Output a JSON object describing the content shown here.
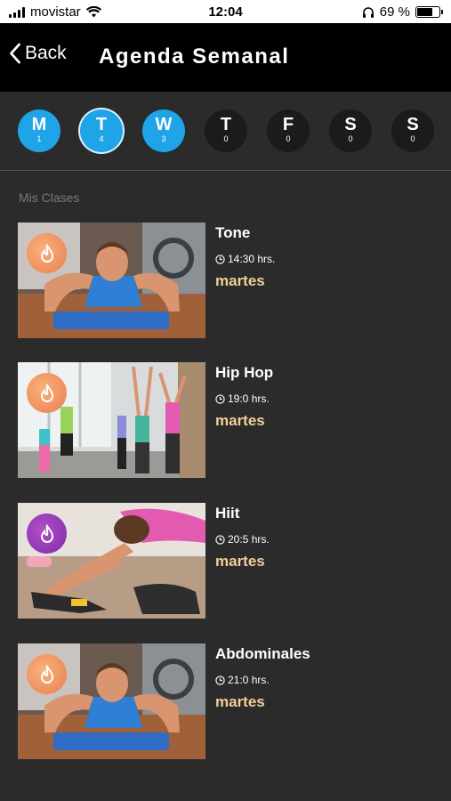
{
  "status_bar": {
    "carrier": "movistar",
    "time": "12:04",
    "battery": "69 %",
    "battery_level": 0.69
  },
  "nav": {
    "back_label": "Back",
    "title": "Agenda Semanal"
  },
  "days": [
    {
      "letter": "M",
      "count": "1",
      "active": true
    },
    {
      "letter": "T",
      "count": "4",
      "active": true,
      "selected": true
    },
    {
      "letter": "W",
      "count": "3",
      "active": true
    },
    {
      "letter": "T",
      "count": "0",
      "active": false
    },
    {
      "letter": "F",
      "count": "0",
      "active": false
    },
    {
      "letter": "S",
      "count": "0",
      "active": false
    },
    {
      "letter": "S",
      "count": "0",
      "active": false
    }
  ],
  "section_label": "Mis Clases",
  "classes": [
    {
      "name": "Tone",
      "time": "14:30 hrs.",
      "day": "martes",
      "image": "pushup-photo",
      "badge_color": "orange"
    },
    {
      "name": "Hip Hop",
      "time": "19:0 hrs.",
      "day": "martes",
      "image": "dance-class-photo",
      "badge_color": "orange"
    },
    {
      "name": "Hiit",
      "time": "20:5 hrs.",
      "day": "martes",
      "image": "stretching-photo",
      "badge_color": "purple"
    },
    {
      "name": "Abdominales",
      "time": "21:0 hrs.",
      "day": "martes",
      "image": "pushup-photo",
      "badge_color": "orange"
    }
  ],
  "colors": {
    "accent": "#1fa4e8",
    "day_text": "#f1cf99",
    "background": "#2b2b2b"
  }
}
